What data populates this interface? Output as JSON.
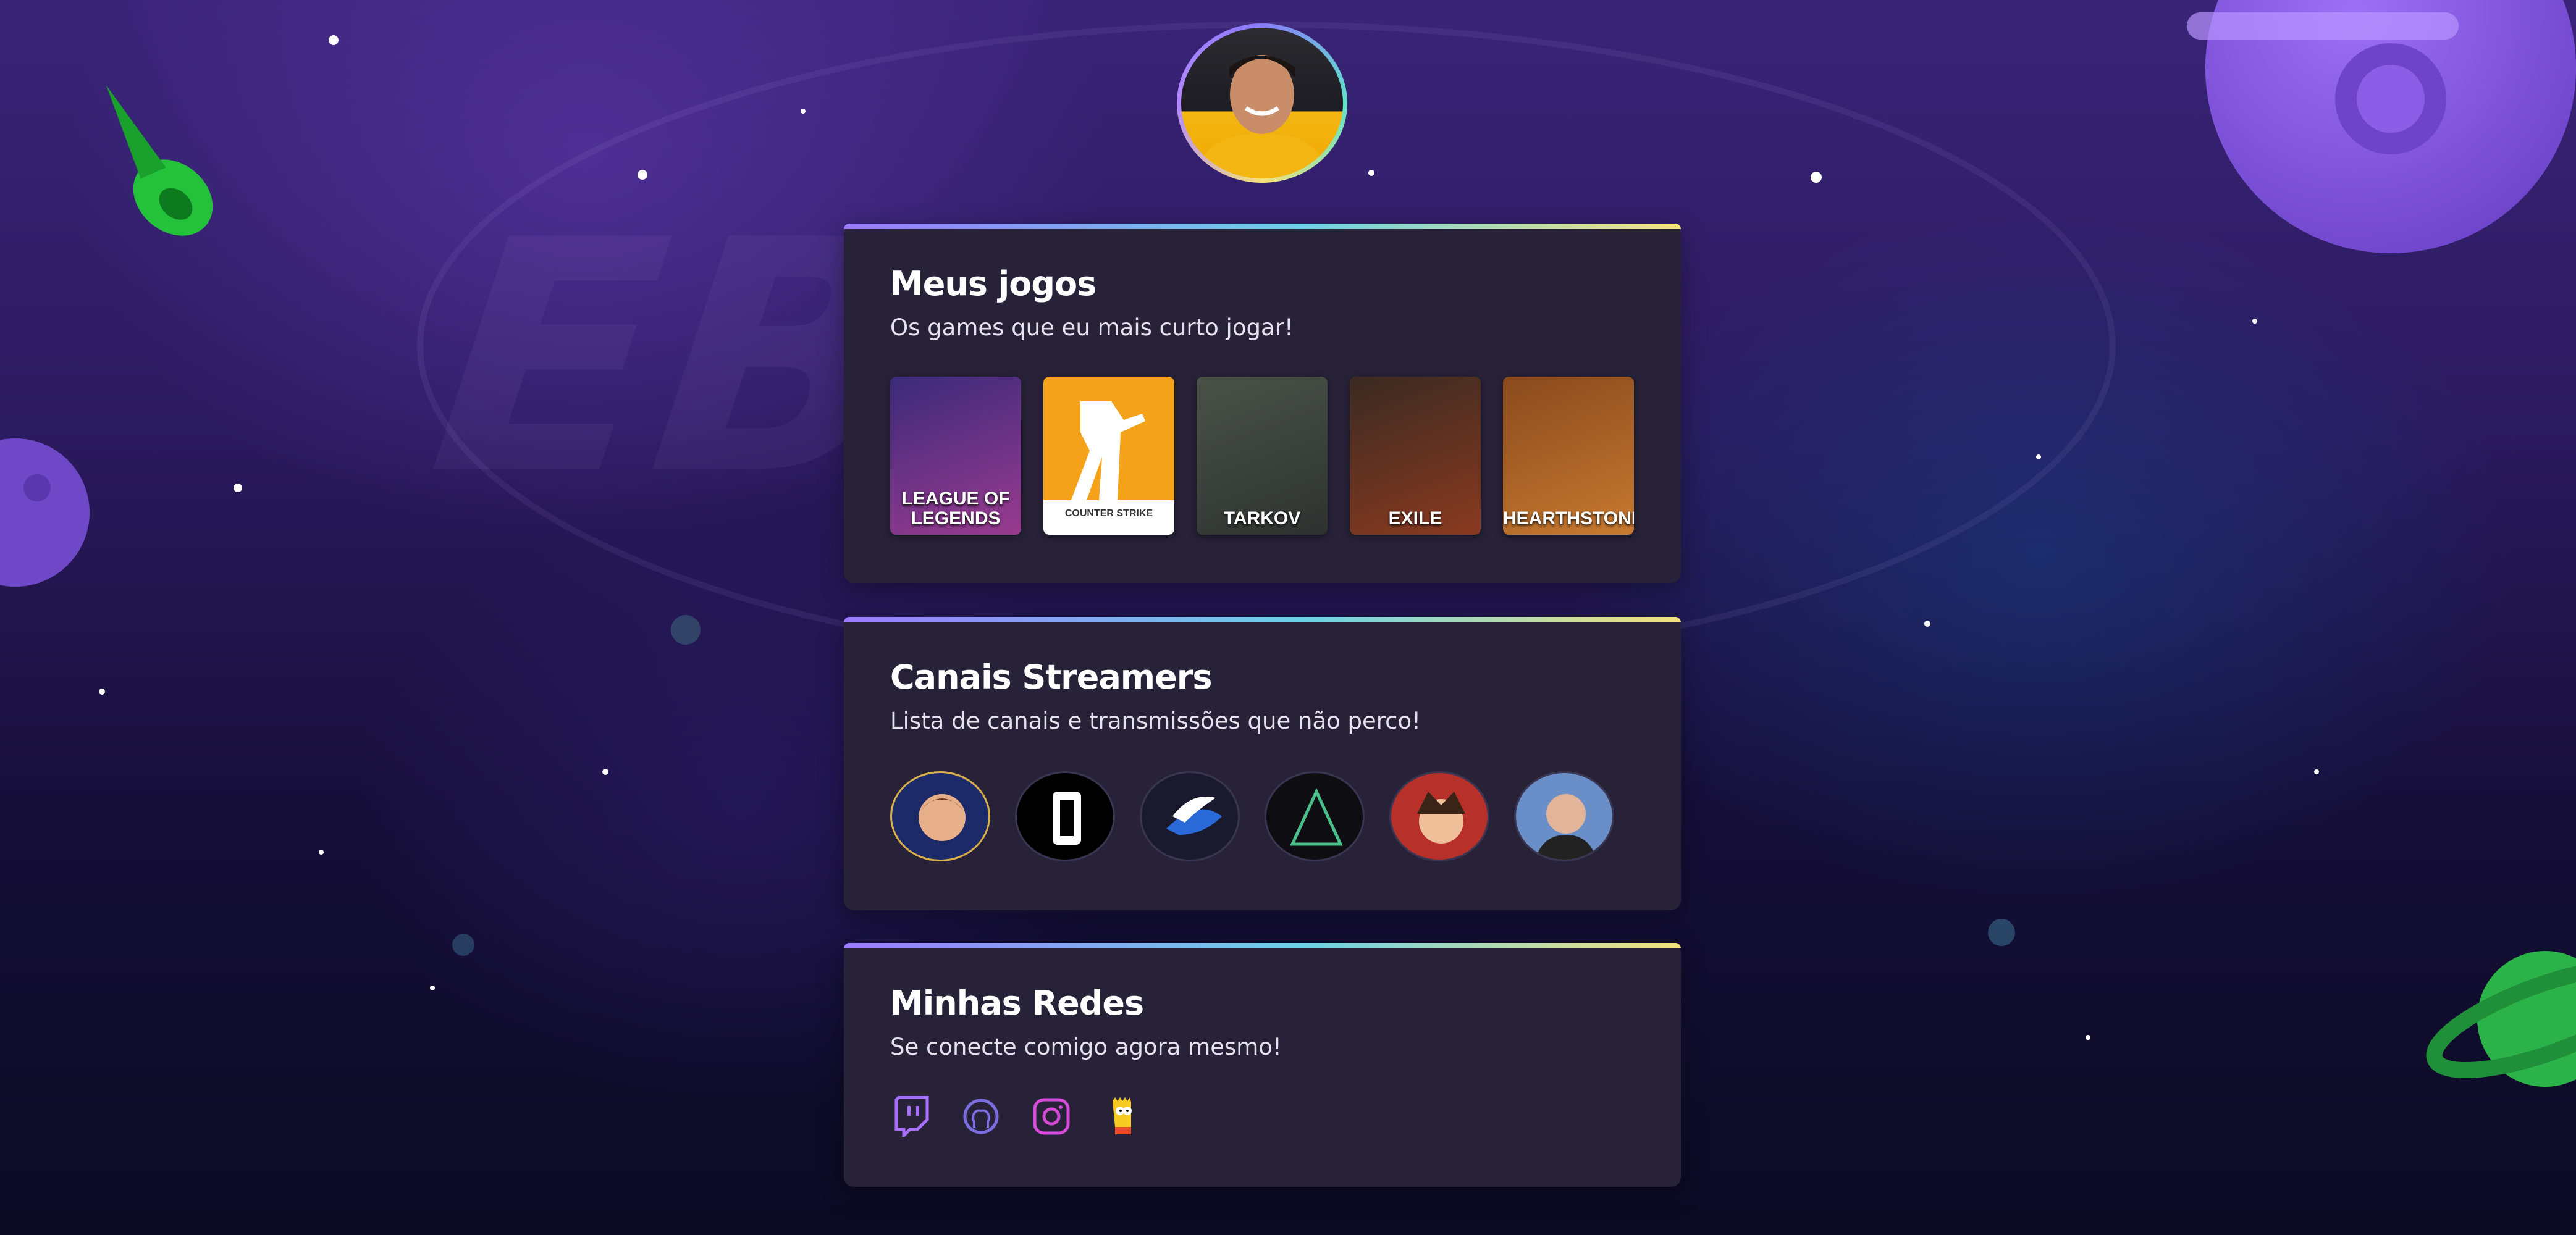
{
  "profile": {
    "avatar_icon": "profile-photo"
  },
  "games_section": {
    "title": "Meus jogos",
    "subtitle": "Os games que eu mais curto jogar!",
    "games": [
      {
        "name": "League of Legends",
        "label": "LEAGUE OF LEGENDS",
        "colors": [
          "#3b2a7a",
          "#9a3b8f"
        ]
      },
      {
        "name": "Counter-Strike",
        "label": "COUNTER STRIKE",
        "colors": [
          "#f5a21b",
          "#f5a21b"
        ]
      },
      {
        "name": "Escape from Tarkov",
        "label": "TARKOV",
        "colors": [
          "#4a5248",
          "#2d3230"
        ]
      },
      {
        "name": "Path of Exile",
        "label": "EXILE",
        "colors": [
          "#3a2a22",
          "#8a3a20"
        ]
      },
      {
        "name": "Hearthstone",
        "label": "HEARTHSTONE",
        "colors": [
          "#8a4a1e",
          "#c77a30"
        ]
      }
    ]
  },
  "streamers_section": {
    "title": "Canais Streamers",
    "subtitle": "Lista de canais e transmissões que não perco!",
    "streamers": [
      {
        "name": "streamer-1",
        "bg": "#1d2a6a",
        "ring": "#d9b04a"
      },
      {
        "name": "streamer-2",
        "bg": "#000000",
        "ring": "#3a3550"
      },
      {
        "name": "streamer-3",
        "bg": "#1a1a2e",
        "ring": "#3a3550"
      },
      {
        "name": "streamer-4",
        "bg": "#0e0e12",
        "ring": "#3a3550"
      },
      {
        "name": "streamer-5",
        "bg": "#b8302a",
        "ring": "#3a3550"
      },
      {
        "name": "streamer-6",
        "bg": "#6a8fc8",
        "ring": "#3a3550"
      }
    ]
  },
  "socials_section": {
    "title": "Minhas Redes",
    "subtitle": "Se conecte comigo agora mesmo!",
    "links": [
      {
        "name": "twitch",
        "icon": "twitch-icon",
        "color": "#a970ff"
      },
      {
        "name": "github",
        "icon": "github-icon",
        "color": "#7b6ee0"
      },
      {
        "name": "instagram",
        "icon": "instagram-icon",
        "color": "#d64bd8"
      },
      {
        "name": "bart",
        "icon": "bart-icon",
        "color": "#f6c923"
      }
    ]
  }
}
